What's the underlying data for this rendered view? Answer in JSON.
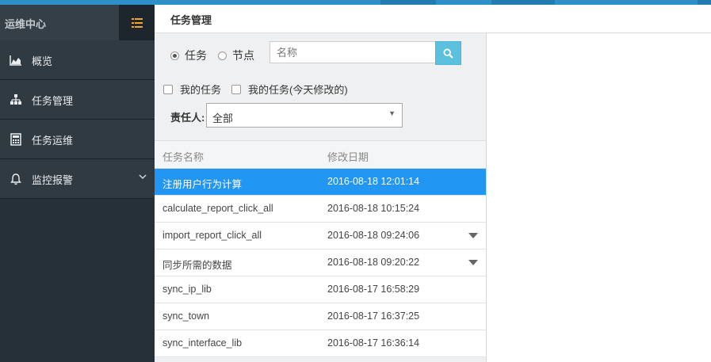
{
  "sidebar": {
    "brand": "运维中心",
    "items": [
      {
        "label": "概览",
        "icon": "area-chart-icon"
      },
      {
        "label": "任务管理",
        "icon": "sitemap-icon"
      },
      {
        "label": "任务运维",
        "icon": "calculator-icon"
      },
      {
        "label": "监控报警",
        "icon": "bell-icon",
        "has_submenu": true
      }
    ]
  },
  "header": {
    "title": "任务管理"
  },
  "filter": {
    "radio_task": "任务",
    "radio_node": "节点",
    "selected_radio": "任务",
    "search_placeholder": "名称",
    "check_my_tasks": "我的任务",
    "check_my_tasks_today": "我的任务(今天修改的)",
    "owner_label": "责任人:",
    "owner_value": "全部"
  },
  "table": {
    "headers": [
      "任务名称",
      "修改日期"
    ],
    "rows": [
      {
        "name": "注册用户行为计算",
        "date": "2016-08-18 12:01:14",
        "selected": true,
        "expandable": false
      },
      {
        "name": "calculate_report_click_all",
        "date": "2016-08-18 10:15:24",
        "selected": false,
        "expandable": false
      },
      {
        "name": "import_report_click_all",
        "date": "2016-08-18 09:24:06",
        "selected": false,
        "expandable": true
      },
      {
        "name": "同步所需的数据",
        "date": "2016-08-18 09:20:22",
        "selected": false,
        "expandable": true
      },
      {
        "name": "sync_ip_lib",
        "date": "2016-08-17 16:58:29",
        "selected": false,
        "expandable": false
      },
      {
        "name": "sync_town",
        "date": "2016-08-17 16:37:25",
        "selected": false,
        "expandable": false
      },
      {
        "name": "sync_interface_lib",
        "date": "2016-08-17 16:36:14",
        "selected": false,
        "expandable": false
      }
    ]
  },
  "colors": {
    "accent": "#2e8fc9",
    "selected_row": "#2196f3",
    "sidebar_bg": "#253038",
    "search_button": "#5bc0de"
  }
}
